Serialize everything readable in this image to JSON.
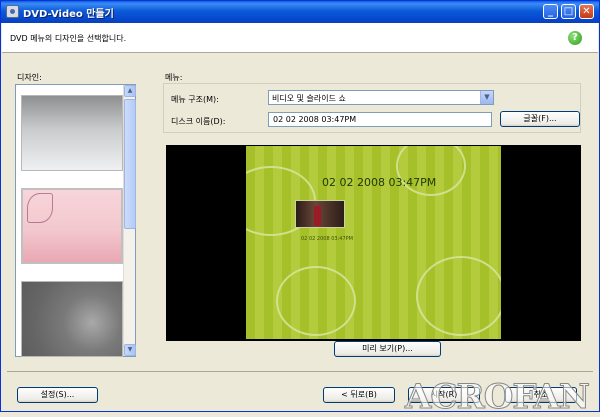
{
  "window": {
    "title": "DVD-Video 만들기",
    "minimize": "_",
    "maximize": "□",
    "close": "✕"
  },
  "header": {
    "message": "DVD 메뉴의 디자인을 선택합니다.",
    "help": "?"
  },
  "design": {
    "label": "디자인:",
    "thumbnails": [
      "회색 그라데이션",
      "분홍 꽃무늬",
      "회색 보케"
    ]
  },
  "menu": {
    "label": "메뉴:",
    "structure_label": "메뉴 구조(M):",
    "structure_value": "비디오 및 슬라이드 쇼",
    "disc_name_label": "디스크 이름(D):",
    "disc_name_value": "02 02 2008  03:47PM",
    "font_button": "글꼴(F)..."
  },
  "preview": {
    "title_text": "02 02 2008  03:47PM",
    "thumb_caption": "02 02 2008  03:47PM",
    "button": "미리 보기(P)..."
  },
  "footer": {
    "settings_button": "설정(S)...",
    "back_button": "< 뒤로(B)",
    "start_button": "시작(R)",
    "cancel_button": "취소",
    "watermark": "ACROFAN"
  }
}
